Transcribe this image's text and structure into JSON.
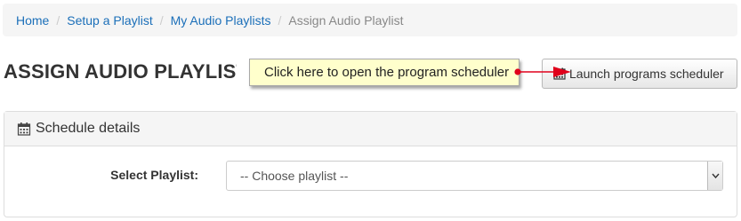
{
  "breadcrumb": {
    "items": [
      "Home",
      "Setup a Playlist",
      "My Audio Playlists"
    ],
    "current": "Assign Audio Playlist",
    "separator": "/"
  },
  "page": {
    "title": "ASSIGN AUDIO PLAYLIST"
  },
  "callout": {
    "text": "Click here to open the program scheduler",
    "arrow_color": "#e0001b"
  },
  "toolbar": {
    "launch_label": "Launch programs scheduler",
    "launch_icon": "calendar-icon"
  },
  "panel": {
    "heading": "Schedule details",
    "heading_icon": "calendar-icon"
  },
  "form": {
    "playlist_label": "Select Playlist:",
    "playlist_value": "-- Choose playlist --"
  },
  "colors": {
    "link": "#1b6fb9",
    "callout_bg": "#ffffcc"
  }
}
